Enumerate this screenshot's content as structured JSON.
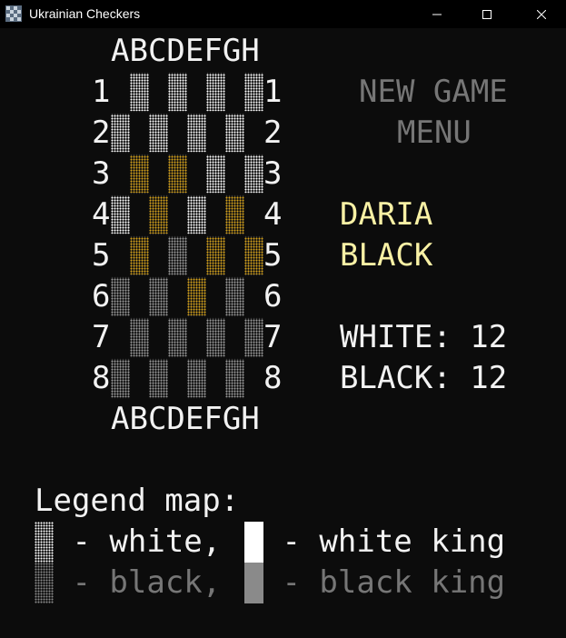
{
  "window": {
    "title": "Ukrainian Checkers",
    "minimize": "—",
    "maximize": "☐",
    "close": "✕"
  },
  "board": {
    "columns": "ABCDEFGH",
    "rows": [
      "1",
      "2",
      "3",
      "4",
      "5",
      "6",
      "7",
      "8"
    ],
    "pieces": [
      {
        "row": 1,
        "col": 1,
        "type": "white"
      },
      {
        "row": 1,
        "col": 3,
        "type": "white"
      },
      {
        "row": 1,
        "col": 5,
        "type": "white"
      },
      {
        "row": 1,
        "col": 7,
        "type": "white"
      },
      {
        "row": 2,
        "col": 0,
        "type": "white"
      },
      {
        "row": 2,
        "col": 2,
        "type": "white"
      },
      {
        "row": 2,
        "col": 4,
        "type": "white"
      },
      {
        "row": 2,
        "col": 6,
        "type": "white"
      },
      {
        "row": 3,
        "col": 1,
        "type": "sel"
      },
      {
        "row": 3,
        "col": 3,
        "type": "sel"
      },
      {
        "row": 3,
        "col": 5,
        "type": "white"
      },
      {
        "row": 3,
        "col": 7,
        "type": "white"
      },
      {
        "row": 4,
        "col": 0,
        "type": "white"
      },
      {
        "row": 4,
        "col": 2,
        "type": "sel"
      },
      {
        "row": 4,
        "col": 4,
        "type": "white"
      },
      {
        "row": 4,
        "col": 6,
        "type": "sel"
      },
      {
        "row": 5,
        "col": 1,
        "type": "sel"
      },
      {
        "row": 5,
        "col": 3,
        "type": "black"
      },
      {
        "row": 5,
        "col": 5,
        "type": "sel"
      },
      {
        "row": 5,
        "col": 7,
        "type": "sel"
      },
      {
        "row": 6,
        "col": 0,
        "type": "black"
      },
      {
        "row": 6,
        "col": 2,
        "type": "black"
      },
      {
        "row": 6,
        "col": 4,
        "type": "sel"
      },
      {
        "row": 6,
        "col": 6,
        "type": "black"
      },
      {
        "row": 7,
        "col": 1,
        "type": "black"
      },
      {
        "row": 7,
        "col": 3,
        "type": "black"
      },
      {
        "row": 7,
        "col": 5,
        "type": "black"
      },
      {
        "row": 7,
        "col": 7,
        "type": "black"
      },
      {
        "row": 8,
        "col": 0,
        "type": "black"
      },
      {
        "row": 8,
        "col": 2,
        "type": "black"
      },
      {
        "row": 8,
        "col": 4,
        "type": "black"
      },
      {
        "row": 8,
        "col": 6,
        "type": "black"
      }
    ]
  },
  "menu": {
    "new_game": "NEW GAME",
    "menu": "MENU"
  },
  "status": {
    "player": "DARIA",
    "side": "BLACK",
    "white_count": "WHITE: 12",
    "black_count": "BLACK: 12"
  },
  "legend": {
    "title": "Legend map:",
    "white": " - white,",
    "white_king": " - white king",
    "black": " - black,",
    "black_king": " - black king"
  },
  "colors": {
    "background": "#0c0c0c",
    "text": "#f2f2f2",
    "dim": "#767676",
    "highlight": "#f9f1a5"
  }
}
